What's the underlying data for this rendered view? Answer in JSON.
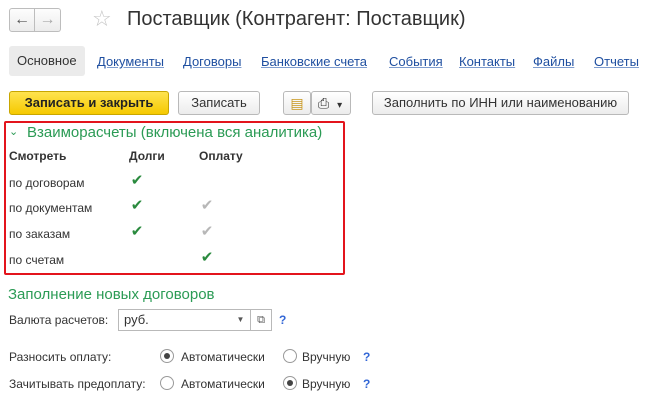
{
  "window": {
    "title": "Поставщик (Контрагент: Поставщик)",
    "back_glyph": "←",
    "forward_glyph": "→",
    "star_glyph": "☆"
  },
  "tabs": {
    "active": "Основное",
    "links": [
      "Документы",
      "Договоры",
      "Банковские счета",
      "События",
      "Контакты",
      "Файлы",
      "Отчеты"
    ]
  },
  "toolbar": {
    "save_close": "Записать и закрыть",
    "save": "Записать",
    "fill_by_inn": "Заполнить по ИНН или наименованию",
    "print_glyph": "⎙",
    "report_glyph": "▤",
    "dropdown_glyph": "▾"
  },
  "settlements": {
    "title": "Взаиморасчеты (включена вся аналитика)",
    "chevron_glyph": "⌄",
    "col_view": "Смотреть",
    "col_debts": "Долги",
    "col_payment": "Оплату",
    "rows": [
      {
        "label": "по договорам",
        "debts": true,
        "payment": null
      },
      {
        "label": "по документам",
        "debts": true,
        "payment": "disabled"
      },
      {
        "label": "по заказам",
        "debts": true,
        "payment": "disabled"
      },
      {
        "label": "по счетам",
        "debts": false,
        "payment": true
      }
    ],
    "check_glyph": "✔"
  },
  "new_contracts": {
    "title": "Заполнение новых договоров",
    "currency_label": "Валюта расчетов:",
    "currency_value": "руб.",
    "help_glyph": "?",
    "distribute_label": "Разносить оплату:",
    "offset_label": "Зачитывать предоплату:",
    "option_auto": "Автоматически",
    "option_manual": "Вручную",
    "distribute_selected": "Автоматически",
    "offset_selected": "Вручную"
  },
  "colors": {
    "accent_green": "#2b9b55",
    "highlight_red": "#e3141c",
    "primary_yellow": "#f5c900",
    "link_blue": "#1f4fa0"
  }
}
